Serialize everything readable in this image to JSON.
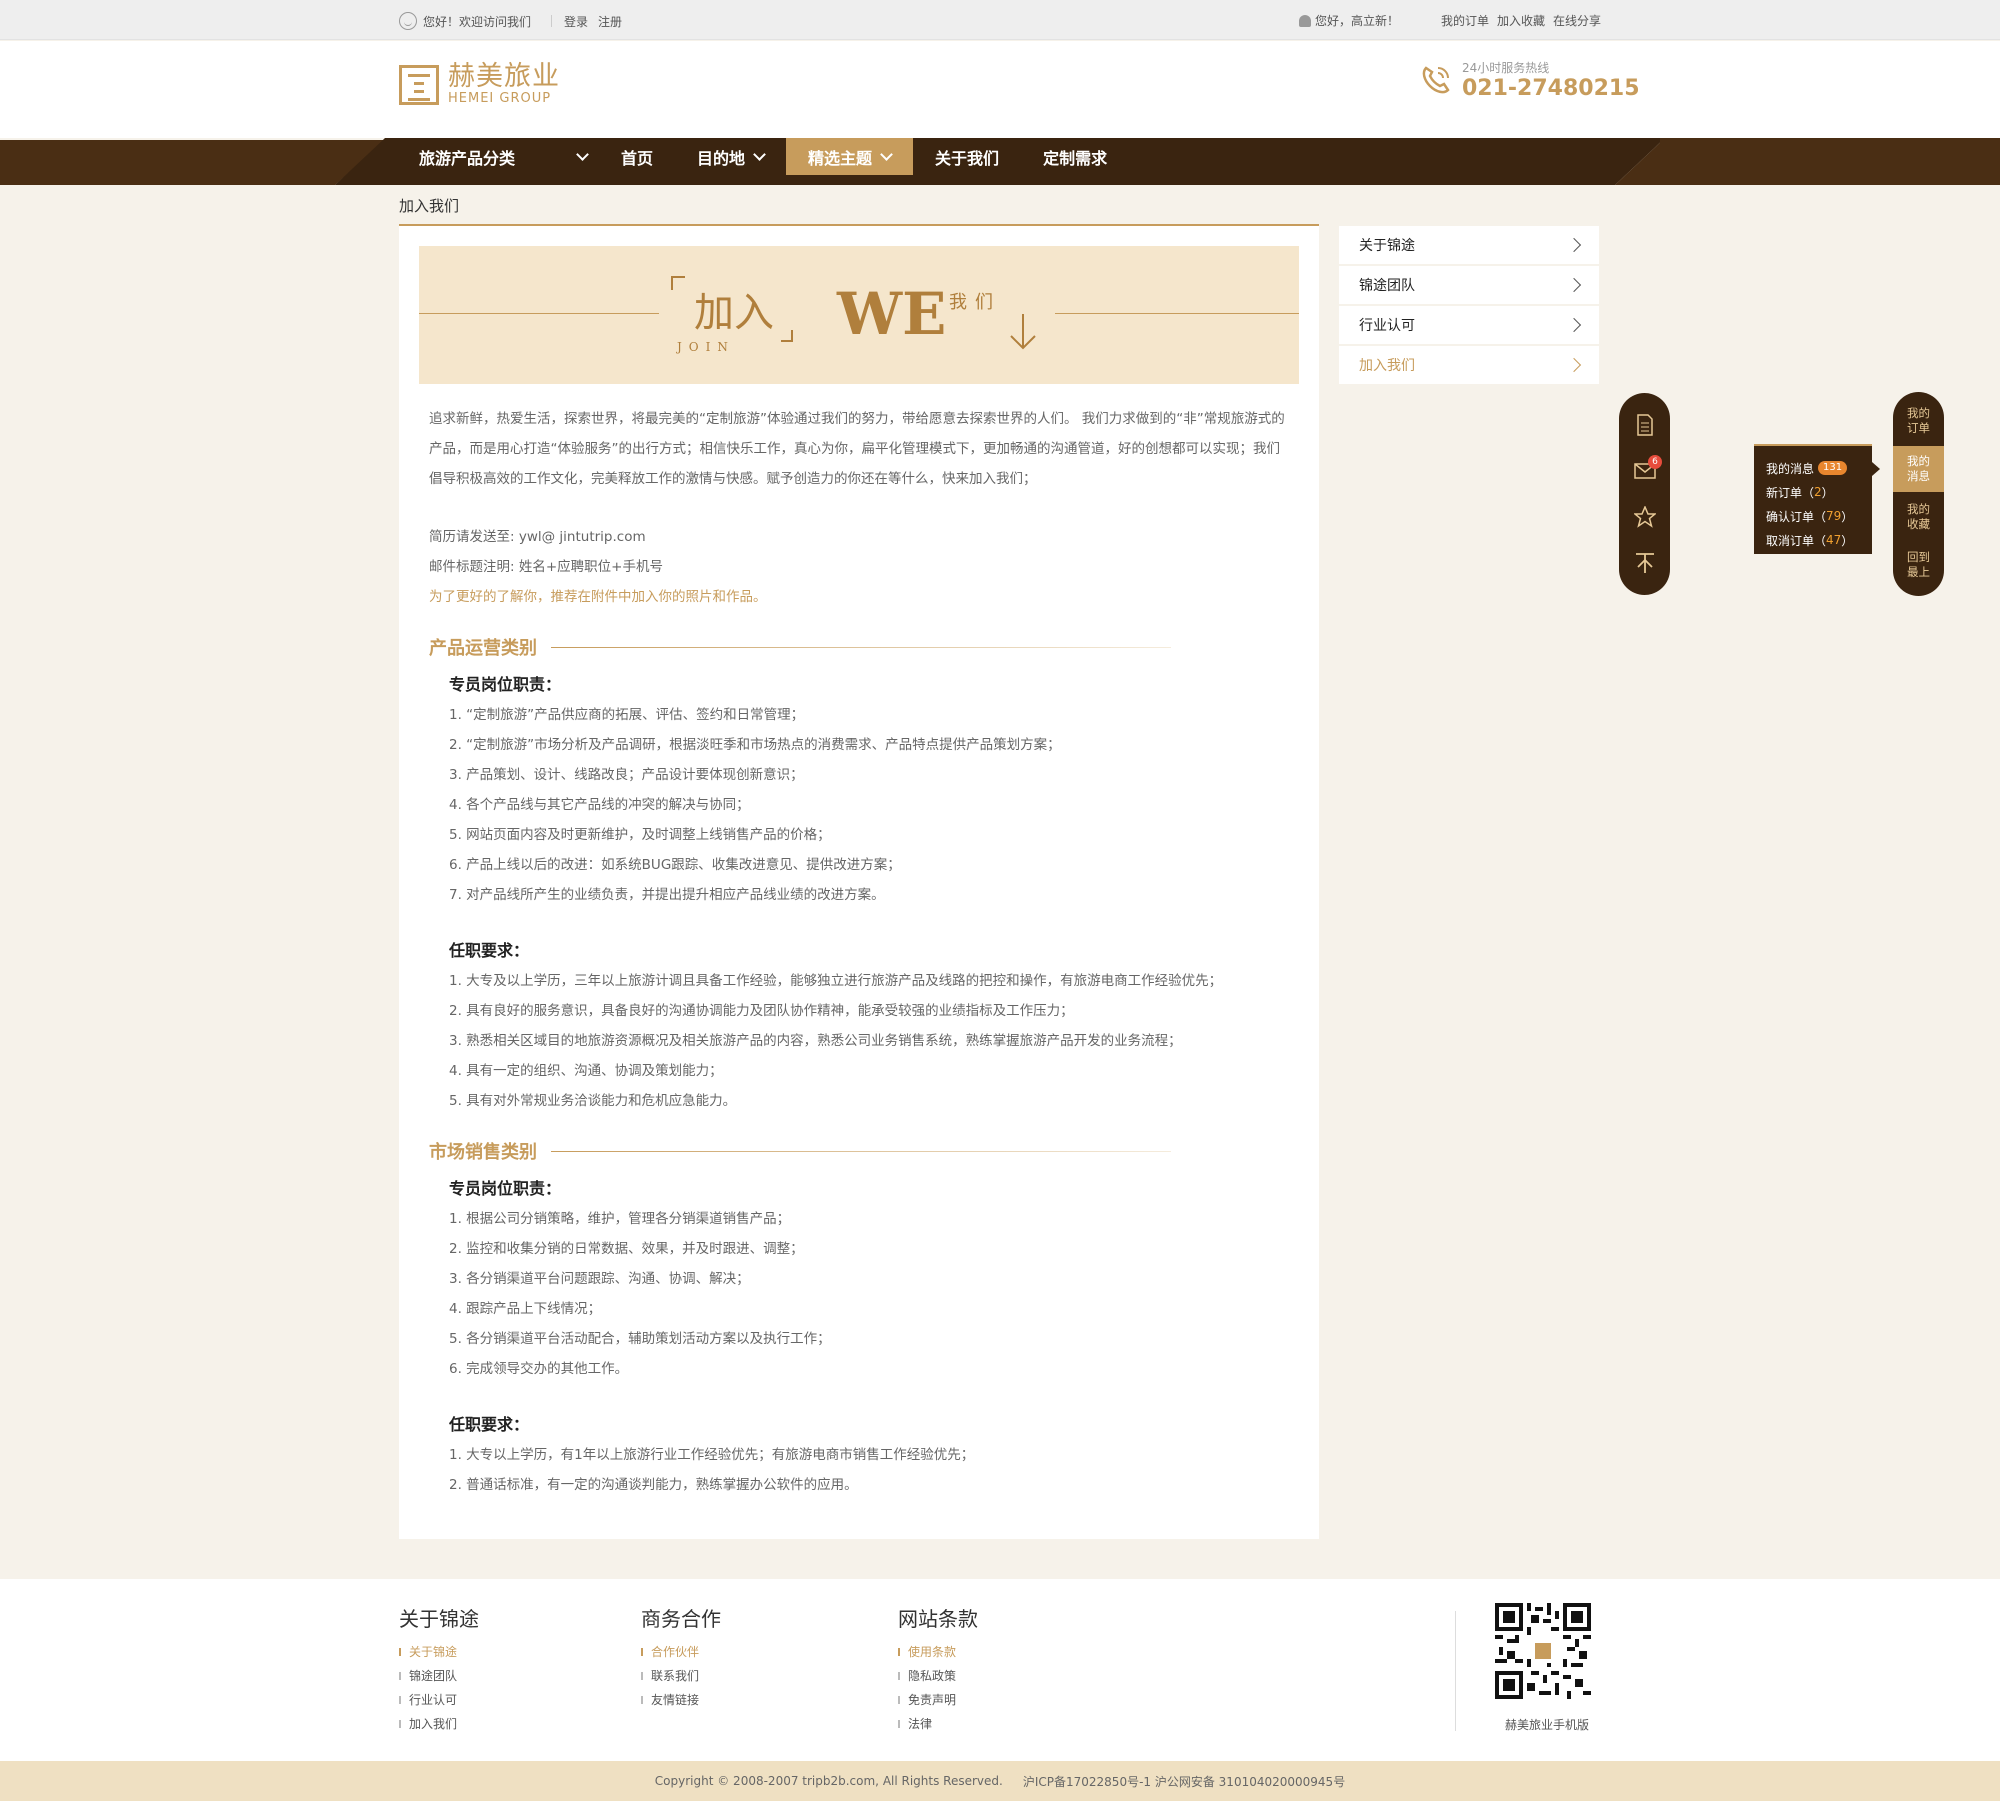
{
  "topbar": {
    "welcome": "您好！欢迎访问我们",
    "login": "登录",
    "register": "注册",
    "user_greeting": "您好，高立新！",
    "links": [
      "我的订单",
      "加入收藏",
      "在线分享"
    ]
  },
  "header": {
    "logo_cn": "赫美旅业",
    "logo_en": "HEMEI GROUP",
    "hotline_label": "24小时服务热线",
    "hotline_number": "021-27480215"
  },
  "nav": {
    "category": "旅游产品分类",
    "items": [
      "首页",
      "目的地",
      "精选主题",
      "关于我们",
      "定制需求"
    ],
    "active": "精选主题"
  },
  "breadcrumb": "加入我们",
  "banner": {
    "title": "加入",
    "sub_en": "JOIN",
    "we": "WE",
    "we_cn": "我们"
  },
  "intro": "追求新鲜，热爱生活，探索世界，将最完美的“定制旅游”体验通过我们的努力，带给愿意去探索世界的人们。 我们力求做到的“非”常规旅游式的产品，而是用心打造“体验服务”的出行方式；相信快乐工作，真心为你，扁平化管理模式下，更加畅通的沟通管道，好的创想都可以实现；我们倡导积极高效的工作文化，完美释放工作的激情与快感。赋予创造力的你还在等什么，快来加入我们；",
  "resume": {
    "email_line": "简历请发送至: ywl@ jintutrip.com",
    "subject_line": "邮件标题注明: 姓名+应聘职位+手机号",
    "tip": "为了更好的了解你，推荐在附件中加入你的照片和作品。"
  },
  "sections": [
    {
      "title": "产品运营类别",
      "duties_title": "专员岗位职责：",
      "duties": [
        "1.  “定制旅游”产品供应商的拓展、评估、签约和日常管理；",
        "2.  “定制旅游”市场分析及产品调研，根据淡旺季和市场热点的消费需求、产品特点提供产品策划方案；",
        "3.  产品策划、设计、线路改良；产品设计要体现创新意识；",
        "4.  各个产品线与其它产品线的冲突的解决与协同；",
        "5.  网站页面内容及时更新维护，及时调整上线销售产品的价格；",
        "6.  产品上线以后的改进：如系统BUG跟踪、收集改进意见、提供改进方案；",
        "7.  对产品线所产生的业绩负责，并提出提升相应产品线业绩的改进方案。"
      ],
      "req_title": "任职要求：",
      "reqs": [
        "1.  大专及以上学历，三年以上旅游计调且具备工作经验，能够独立进行旅游产品及线路的把控和操作，有旅游电商工作经验优先；",
        "2.  具有良好的服务意识，具备良好的沟通协调能力及团队协作精神，能承受较强的业绩指标及工作压力；",
        "3.  熟悉相关区域目的地旅游资源概况及相关旅游产品的内容，熟悉公司业务销售系统，熟练掌握旅游产品开发的业务流程；",
        "4.  具有一定的组织、沟通、协调及策划能力；",
        "5.  具有对外常规业务洽谈能力和危机应急能力。"
      ]
    },
    {
      "title": "市场销售类别",
      "duties_title": "专员岗位职责：",
      "duties": [
        "1.  根据公司分销策略，维护，管理各分销渠道销售产品；",
        "2.  监控和收集分销的日常数据、效果，并及时跟进、调整；",
        "3.  各分销渠道平台问题跟踪、沟通、协调、解决；",
        "4.  跟踪产品上下线情况；",
        "5.  各分销渠道平台活动配合，辅助策划活动方案以及执行工作；",
        "6.   完成领导交办的其他工作。"
      ],
      "req_title": "任职要求：",
      "reqs": [
        "1.  大专以上学历，有1年以上旅游行业工作经验优先；有旅游电商市销售工作经验优先；",
        "2.   普通话标准，有一定的沟通谈判能力，熟练掌握办公软件的应用。"
      ]
    }
  ],
  "sidebar": {
    "items": [
      "关于锦途",
      "锦途团队",
      "行业认可",
      "加入我们"
    ],
    "current": "加入我们"
  },
  "float_left": {
    "badge": "6",
    "icons": [
      "document-icon",
      "mail-icon",
      "star-icon",
      "back-to-top-icon"
    ]
  },
  "float_right": {
    "items": [
      "我的订单",
      "我的消息",
      "我的收藏",
      "回到最上"
    ],
    "active": "我的消息"
  },
  "popup": {
    "messages_label": "我的消息",
    "messages_count": "131",
    "rows": [
      {
        "label": "新订单（",
        "count": "2",
        "end": "）"
      },
      {
        "label": "确认订单（",
        "count": "79",
        "end": "）"
      },
      {
        "label": "取消订单（",
        "count": "47",
        "end": "）"
      }
    ]
  },
  "footer": {
    "columns": [
      {
        "title": "关于锦途",
        "links": [
          "关于锦途",
          "锦途团队",
          "行业认可",
          "加入我们"
        ]
      },
      {
        "title": "商务合作",
        "links": [
          "合作伙伴",
          "联系我们",
          "友情链接"
        ]
      },
      {
        "title": "网站条款",
        "links": [
          "使用条款",
          "隐私政策",
          "免责声明",
          "法律"
        ]
      }
    ],
    "qr_label": "赫美旅业手机版",
    "copyright": "Copyright © 2008-2007 tripb2b.com, All Rights Reserved.",
    "icp": "沪ICP备17022850号-1 沪公网安备 310104020000945号"
  },
  "colors": {
    "brand": "#c79c5c",
    "nav_dark": "#3a2410",
    "banner_bg": "#f5e6cc",
    "page_bg": "#f6f2ea"
  }
}
